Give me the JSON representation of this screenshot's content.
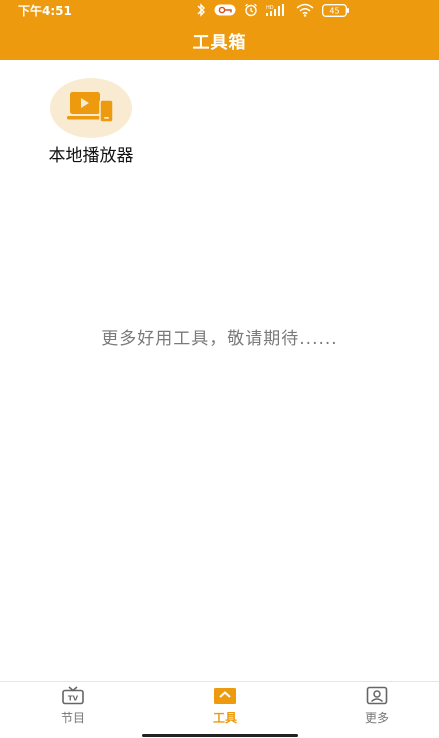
{
  "status_bar": {
    "time": "下午4:51",
    "icons": [
      "bluetooth-icon",
      "vpn-key-icon",
      "alarm-icon",
      "hd-signal-icon",
      "wifi-icon",
      "battery-icon"
    ],
    "battery_level": "45"
  },
  "header": {
    "title": "工具箱"
  },
  "tools": [
    {
      "label": "本地播放器",
      "icon": "local-player-icon"
    }
  ],
  "message": "更多好用工具，敬请期待......",
  "bottom_nav": [
    {
      "label": "节目",
      "icon": "tv-icon",
      "active": false
    },
    {
      "label": "工具",
      "icon": "toolbox-icon",
      "active": true
    },
    {
      "label": "更多",
      "icon": "profile-icon",
      "active": false
    }
  ],
  "colors": {
    "accent": "#ED9A0E",
    "icon_bg": "#F8EBD2",
    "muted_text": "#7A7A7A"
  }
}
